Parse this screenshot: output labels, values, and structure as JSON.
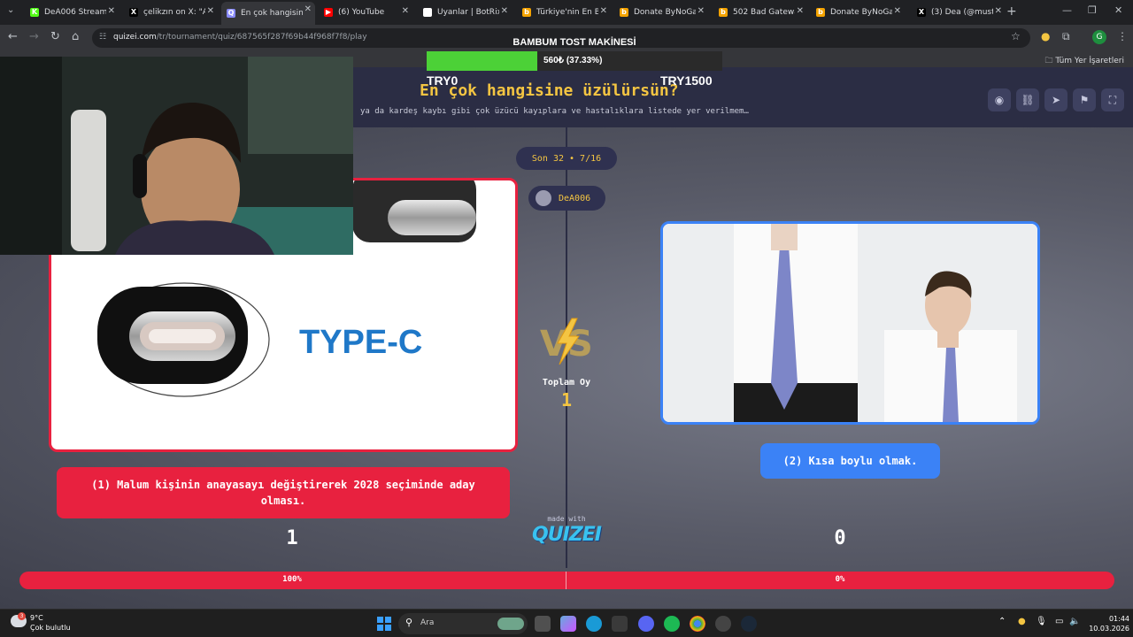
{
  "browser": {
    "tabs": [
      {
        "title": "DeA006 Stream -",
        "favicon": "kick-icon",
        "color": "#53fc18",
        "glyph": "K"
      },
      {
        "title": "çelikzın on X: \"Ab",
        "favicon": "x-icon",
        "color": "#000000",
        "glyph": "X"
      },
      {
        "title": "En çok hangisine",
        "favicon": "quizei-icon",
        "color": "#8a8cff",
        "glyph": "Q"
      },
      {
        "title": "(6) YouTube",
        "favicon": "youtube-icon",
        "color": "#ff0000",
        "glyph": "▶"
      },
      {
        "title": "Uyanlar | BotRix -",
        "favicon": "botrix-icon",
        "color": "#ffffff",
        "glyph": "B"
      },
      {
        "title": "Türkiye'nin En Bü",
        "favicon": "bynogame-icon",
        "color": "#f4a300",
        "glyph": "b"
      },
      {
        "title": "Donate ByNoGam",
        "favicon": "bynogame-icon",
        "color": "#f4a300",
        "glyph": "b"
      },
      {
        "title": "502 Bad Gateway",
        "favicon": "bynogame-icon",
        "color": "#f4a300",
        "glyph": "b"
      },
      {
        "title": "Donate ByNoGam",
        "favicon": "bynogame-icon",
        "color": "#f4a300",
        "glyph": "b"
      },
      {
        "title": "(3) Dea (@mustaf",
        "favicon": "x-icon",
        "color": "#000000",
        "glyph": "X"
      }
    ],
    "url_host": "quizei.com",
    "url_path": "/tr/tournament/quiz/687565f287f69b44f968f7f8/play",
    "bookmarks_all": "Tüm Yer İşaretleri",
    "profile_initial": "G"
  },
  "quiz": {
    "title": "En çok hangisine üzülürsün?",
    "description": "ya da kardeş kaybı gibi çok üzücü kayıplara ve hastalıklara listede yer verilmem…",
    "round": "Son 32 • 7/16",
    "user": "DeA006",
    "vs": "VS",
    "total_votes_label": "Toplam Oy",
    "total_votes": "1",
    "left": {
      "image_text": "TYPE-C",
      "label": "(1) Malum kişinin anayasayı değiştirerek 2028 seçiminde aday olması.",
      "count": "1",
      "percent_label": "100%"
    },
    "right": {
      "label": "(2) Kısa boylu olmak.",
      "count": "0",
      "percent_label": "0%"
    },
    "made_with": "made with",
    "logo": "QUIZEI",
    "colors": {
      "left": "#e8213f",
      "right": "#3b82f6",
      "accent": "#f4c542"
    }
  },
  "donation": {
    "title": "BAMBUM TOST MAKİNESİ",
    "progress_text": "560₺ (37.33%)",
    "progress": 0.3733,
    "min": "TRY0",
    "max": "TRY1500"
  },
  "taskbar": {
    "temperature": "9°C",
    "condition": "Çok bulutlu",
    "weather_badge": "3",
    "search": "Ara",
    "time": "01:44",
    "date": "10.03.2026"
  }
}
